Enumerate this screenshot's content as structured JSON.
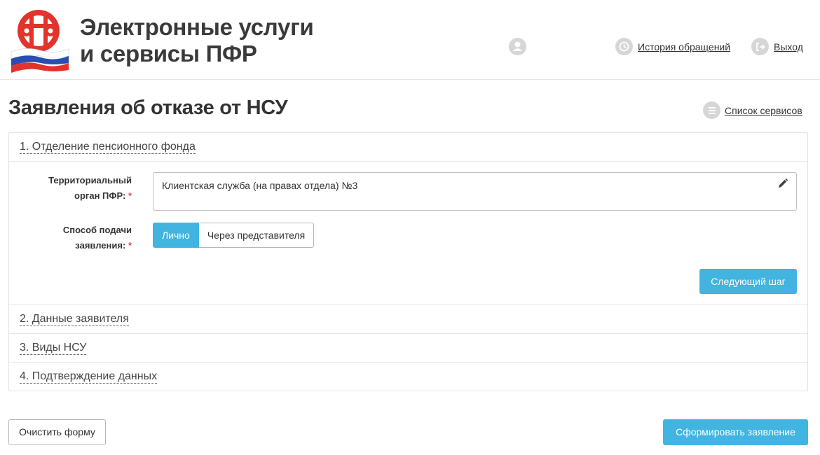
{
  "header": {
    "brand_line1": "Электронные услуги",
    "brand_line2": "и сервисы ПФР",
    "history_link": "История обращений",
    "exit_link": "Выход"
  },
  "page": {
    "title": "Заявления об отказе от НСУ",
    "services_link": "Список сервисов"
  },
  "sections": [
    {
      "title": "1. Отделение пенсионного фонда"
    },
    {
      "title": "2. Данные заявителя"
    },
    {
      "title": "3. Виды НСУ"
    },
    {
      "title": "4. Подтверждение данных"
    }
  ],
  "form": {
    "territorial_label_line1": "Территориальный",
    "territorial_label_line2": "орган ПФР:",
    "territorial_value": "Клиентская служба (на правах отдела) №3",
    "method_label_line1": "Способ подачи",
    "method_label_line2": "заявления:",
    "required_mark": "*",
    "method_options": [
      "Лично",
      "Через представителя"
    ],
    "method_selected": "Лично",
    "next_button": "Следующий шаг"
  },
  "footer": {
    "clear_button": "Очистить форму",
    "submit_button": "Сформировать заявление"
  },
  "colors": {
    "accent": "#41b4df",
    "required": "#d9534f",
    "logo_red": "#e2342b",
    "logo_blue": "#2a4db0"
  },
  "icons": [
    "pfr-logo",
    "user-icon",
    "history-icon",
    "exit-icon",
    "list-icon",
    "pencil-icon"
  ]
}
